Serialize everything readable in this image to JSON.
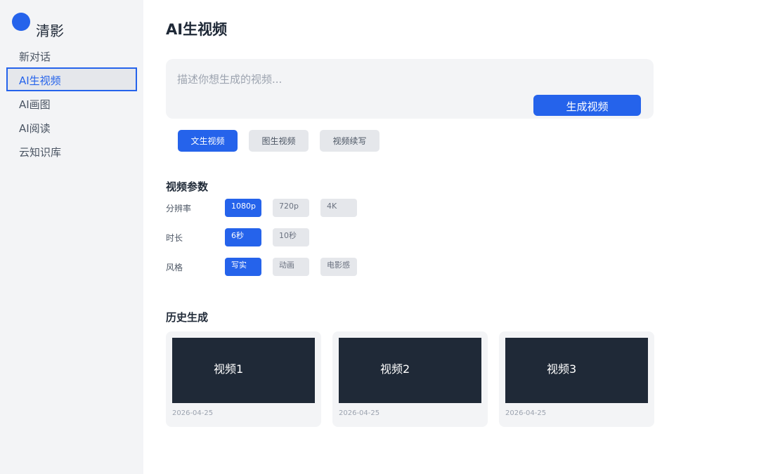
{
  "brand": {
    "name": "清影",
    "color": "#2563eb"
  },
  "sidebar": {
    "items": [
      {
        "label": "新对话",
        "active": false
      },
      {
        "label": "AI生视频",
        "active": true
      },
      {
        "label": "AI画图",
        "active": false
      },
      {
        "label": "AI阅读",
        "active": false
      },
      {
        "label": "云知识库",
        "active": false
      }
    ]
  },
  "page": {
    "title": "AI生视频"
  },
  "prompt": {
    "placeholder": "描述你想生成的视频...",
    "value": "",
    "generate_label": "生成视频"
  },
  "mode_tabs": [
    {
      "label": "文生视频",
      "active": true
    },
    {
      "label": "图生视频",
      "active": false
    },
    {
      "label": "视频续写",
      "active": false
    }
  ],
  "params": {
    "title": "视频参数",
    "resolution": {
      "label": "分辨率",
      "options": [
        "1080p",
        "720p",
        "4K"
      ],
      "selected": "1080p"
    },
    "duration": {
      "label": "时长",
      "options": [
        "6秒",
        "10秒"
      ],
      "selected": "6秒"
    },
    "style": {
      "label": "风格",
      "options": [
        "写实",
        "动画",
        "电影感"
      ],
      "selected": "写实"
    }
  },
  "history": {
    "title": "历史生成",
    "items": [
      {
        "title": "视频1",
        "date": "2026-04-25"
      },
      {
        "title": "视频2",
        "date": "2026-04-25"
      },
      {
        "title": "视频3",
        "date": "2026-04-25"
      }
    ]
  },
  "colors": {
    "accent": "#2563eb",
    "sidebar_bg": "#f3f4f6",
    "thumbnail_bg": "#1f2937"
  }
}
